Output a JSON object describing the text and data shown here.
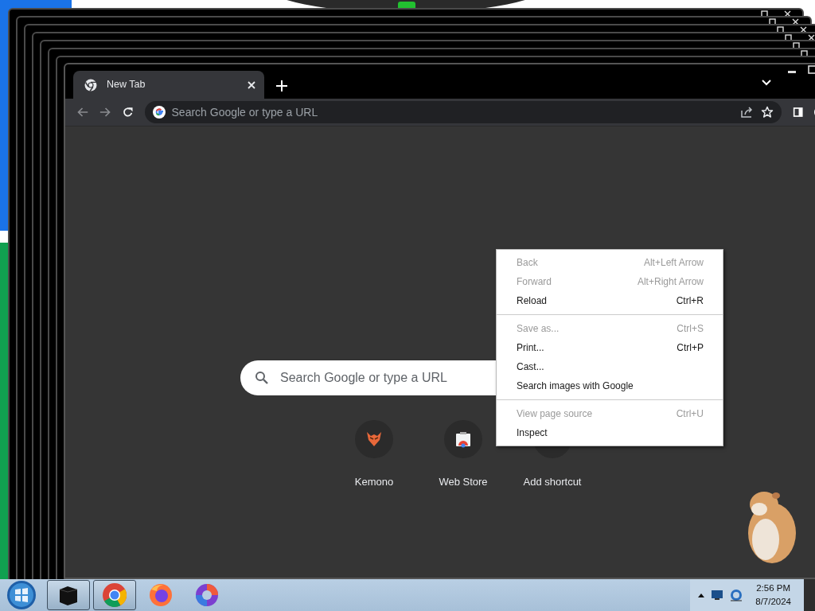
{
  "tab": {
    "title": "New Tab",
    "selected": true
  },
  "address_bar": {
    "placeholder": "Search Google or type a URL"
  },
  "search_box": {
    "placeholder": "Search Google or type a URL"
  },
  "shortcuts": [
    {
      "label": "Kemono",
      "kind": "site"
    },
    {
      "label": "Web Store",
      "kind": "store"
    },
    {
      "label": "Add shortcut",
      "kind": "add"
    }
  ],
  "context_menu": {
    "groups": [
      {
        "items": [
          {
            "label": "Back",
            "shortcut": "Alt+Left Arrow",
            "disabled": true
          },
          {
            "label": "Forward",
            "shortcut": "Alt+Right Arrow",
            "disabled": true
          },
          {
            "label": "Reload",
            "shortcut": "Ctrl+R",
            "disabled": false
          }
        ]
      },
      {
        "items": [
          {
            "label": "Save as...",
            "shortcut": "Ctrl+S",
            "disabled": true
          },
          {
            "label": "Print...",
            "shortcut": "Ctrl+P",
            "disabled": false
          },
          {
            "label": "Cast...",
            "disabled": false
          },
          {
            "label": "Search images with Google",
            "disabled": false
          }
        ]
      },
      {
        "items": [
          {
            "label": "View page source",
            "shortcut": "Ctrl+U",
            "disabled": true
          },
          {
            "label": "Inspect",
            "disabled": false
          }
        ]
      }
    ]
  },
  "taskbar": {
    "apps": [
      {
        "kind": "terminal",
        "running": true
      },
      {
        "kind": "chrome",
        "running": true
      },
      {
        "kind": "firefox",
        "running": false
      },
      {
        "kind": "swirl",
        "running": false
      }
    ],
    "clock": {
      "time": "2:56 PM",
      "date": "8/7/2024"
    }
  }
}
